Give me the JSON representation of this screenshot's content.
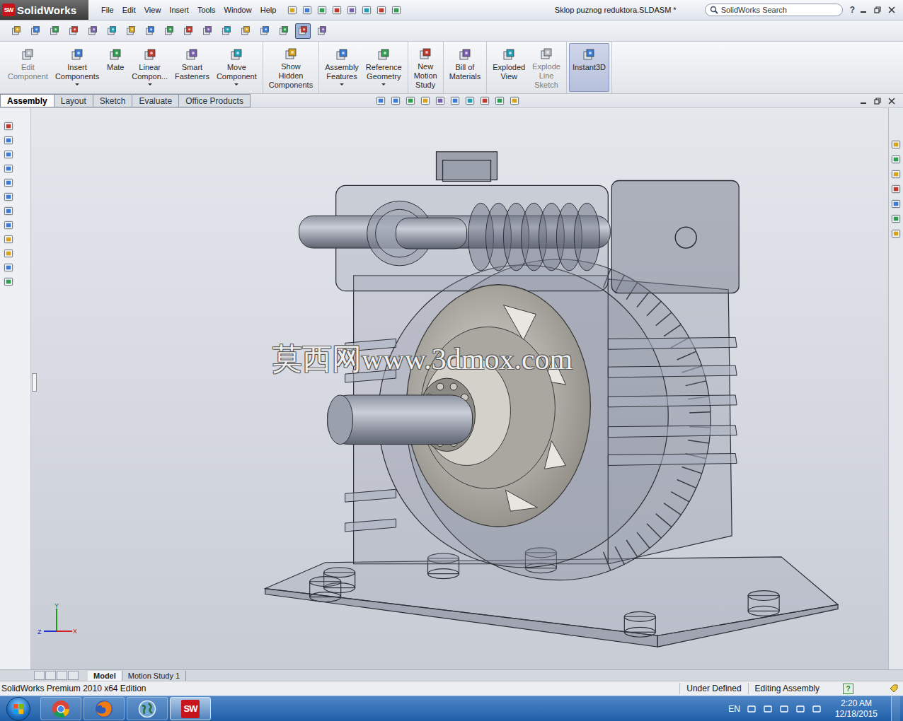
{
  "app": {
    "logo": "SolidWorks",
    "badge": "SW"
  },
  "menu": [
    "File",
    "Edit",
    "View",
    "Insert",
    "Tools",
    "Window",
    "Help"
  ],
  "window": {
    "title": "Sklop puznog reduktora.SLDASM *"
  },
  "search": {
    "placeholder": "SolidWorks Search"
  },
  "help": "?",
  "view_toolbar": [
    {
      "selected": false
    },
    {
      "selected": false
    },
    {
      "selected": false
    },
    {
      "selected": false
    },
    {
      "selected": false
    },
    {
      "selected": false
    },
    {
      "selected": false
    },
    {
      "selected": false
    },
    {
      "selected": false
    },
    {
      "selected": false
    },
    {
      "selected": false
    },
    {
      "selected": false
    },
    {
      "selected": false
    },
    {
      "selected": false
    },
    {
      "selected": false
    },
    {
      "selected": true
    },
    {
      "selected": false
    }
  ],
  "ribbon": {
    "groups": [
      [
        {
          "lines": [
            "Edit",
            "Component"
          ],
          "disabled": true,
          "selected": false,
          "dropdown": false
        },
        {
          "lines": [
            "Insert",
            "Components"
          ],
          "disabled": false,
          "selected": false,
          "dropdown": true
        },
        {
          "lines": [
            "Mate"
          ],
          "disabled": false,
          "selected": false,
          "dropdown": false
        },
        {
          "lines": [
            "Linear",
            "Compon..."
          ],
          "disabled": false,
          "selected": false,
          "dropdown": true
        },
        {
          "lines": [
            "Smart",
            "Fasteners"
          ],
          "disabled": false,
          "selected": false,
          "dropdown": false
        },
        {
          "lines": [
            "Move",
            "Component"
          ],
          "disabled": false,
          "selected": false,
          "dropdown": true
        }
      ],
      [
        {
          "lines": [
            "Show",
            "Hidden",
            "Components"
          ],
          "disabled": false,
          "selected": false,
          "dropdown": false
        }
      ],
      [
        {
          "lines": [
            "Assembly",
            "Features"
          ],
          "disabled": false,
          "selected": false,
          "dropdown": true
        },
        {
          "lines": [
            "Reference",
            "Geometry"
          ],
          "disabled": false,
          "selected": false,
          "dropdown": true
        }
      ],
      [
        {
          "lines": [
            "New",
            "Motion",
            "Study"
          ],
          "disabled": false,
          "selected": false,
          "dropdown": false
        }
      ],
      [
        {
          "lines": [
            "Bill of",
            "Materials"
          ],
          "disabled": false,
          "selected": false,
          "dropdown": false
        }
      ],
      [
        {
          "lines": [
            "Exploded",
            "View"
          ],
          "disabled": false,
          "selected": false,
          "dropdown": false
        },
        {
          "lines": [
            "Explode",
            "Line",
            "Sketch"
          ],
          "disabled": true,
          "selected": false,
          "dropdown": false
        }
      ],
      [
        {
          "lines": [
            "Instant3D"
          ],
          "disabled": false,
          "selected": true,
          "dropdown": false
        }
      ]
    ]
  },
  "tabs": [
    {
      "label": "Assembly",
      "selected": true
    },
    {
      "label": "Layout",
      "selected": false
    },
    {
      "label": "Sketch",
      "selected": false
    },
    {
      "label": "Evaluate",
      "selected": false
    },
    {
      "label": "Office Products",
      "selected": false
    }
  ],
  "watermark": "莫西网www.3dmox.com",
  "triad": {
    "x": "X",
    "y": "Y",
    "z": "Z"
  },
  "model_tabs": [
    {
      "label": "Model",
      "selected": true
    },
    {
      "label": "Motion Study 1",
      "selected": false
    }
  ],
  "status_bar": {
    "edition": "SolidWorks Premium 2010 x64 Edition",
    "state": "Under Defined",
    "mode": "Editing Assembly",
    "help": "?"
  },
  "taskbar": {
    "apps": [
      {
        "kind": "chrome",
        "active": false,
        "label": ""
      },
      {
        "kind": "firefox",
        "active": false,
        "label": ""
      },
      {
        "kind": "globe",
        "active": false,
        "label": ""
      },
      {
        "kind": "solidworks",
        "active": true,
        "label": "SW"
      }
    ],
    "language": "EN",
    "time": "2:20 AM",
    "date": "12/18/2015"
  }
}
